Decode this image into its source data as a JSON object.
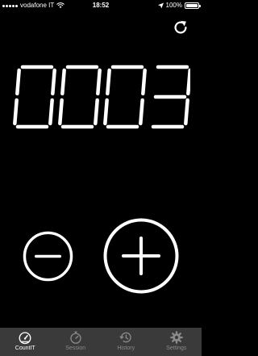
{
  "status_bar": {
    "carrier": "vodafone IT",
    "time": "18:52",
    "battery": "100%",
    "battery_level": 1.0
  },
  "counter": {
    "value": "0003"
  },
  "tabs": [
    {
      "label": "CountIT",
      "icon": "gauge-icon",
      "active": true
    },
    {
      "label": "Session",
      "icon": "stopwatch-icon",
      "active": false
    },
    {
      "label": "History",
      "icon": "history-icon",
      "active": false
    },
    {
      "label": "Settings",
      "icon": "gear-icon",
      "active": false
    }
  ],
  "colors": {
    "background": "#000000",
    "foreground": "#ffffff",
    "tabbar": "#3a3a3a",
    "tab_inactive": "#8a8a8a"
  }
}
